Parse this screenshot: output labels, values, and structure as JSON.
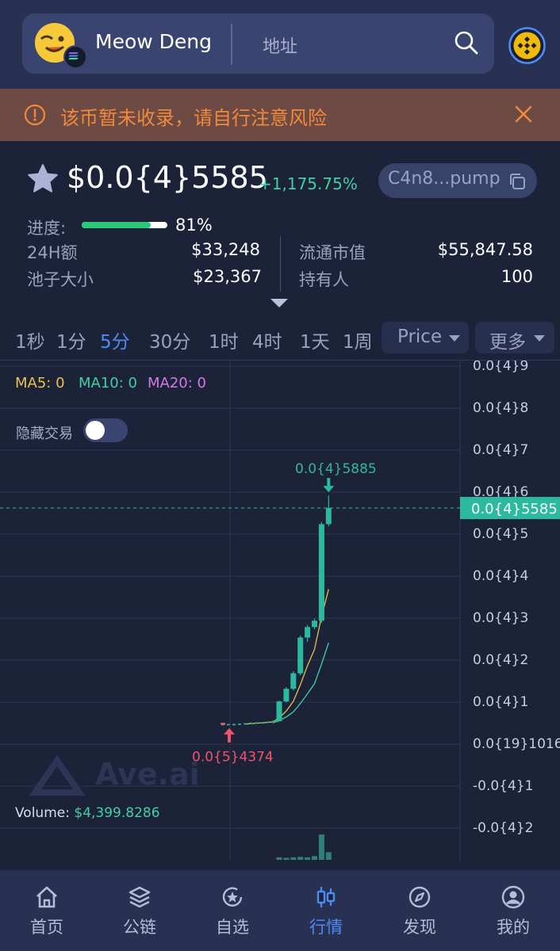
{
  "header": {
    "token_name": "Meow Deng",
    "address_placeholder": "地址",
    "icons": [
      "token-avatar-icon",
      "solana-chain-icon",
      "search-icon",
      "bnb-chain-icon"
    ]
  },
  "warning": {
    "text": "该币暂未收录，请自行注意风险",
    "color": "#f08a3a"
  },
  "token": {
    "price": "$0.0{4}5585",
    "change": "+1,175.75%",
    "address": "C4n8...pump"
  },
  "stats": {
    "progress_label": "进度:",
    "progress_percent": 81,
    "progress_text": "81%",
    "volume_24h_label": "24H额",
    "volume_24h": "$33,248",
    "pool_label": "池子大小",
    "pool": "$23,367",
    "mcap_label": "流通市值",
    "mcap": "$55,847.58",
    "holders_label": "持有人",
    "holders": "100"
  },
  "timeframes": {
    "items": [
      "1秒",
      "1分",
      "5分",
      "30分",
      "1时",
      "4时",
      "1天",
      "1周"
    ],
    "active": "5分",
    "price_dropdown": "Price",
    "more_dropdown": "更多"
  },
  "chart": {
    "ma5": "MA5: 0",
    "ma10": "MA10: 0",
    "ma20": "MA20: 0",
    "hide_trades_label": "隐藏交易",
    "watermark": "Ave.ai",
    "volume_label": "Volume:",
    "volume_value": "$4,399.8286",
    "current_price_tag": "0.0{4}5585",
    "high_label": "0.0{4}5885",
    "low_label": "0.0{5}4374",
    "y_axis": [
      "0.0{4}9",
      "0.0{4}8",
      "0.0{4}7",
      "0.0{4}6",
      "0.0{4}5",
      "0.0{4}4",
      "0.0{4}3",
      "0.0{4}2",
      "0.0{4}1",
      "0.0{19}1016",
      "-0.0{4}1",
      "-0.0{4}2"
    ],
    "colors": {
      "up": "#2bb9a0",
      "down": "#f0556b",
      "ma5": "#e8c34a",
      "ma10": "#3fd0a4",
      "ma20": "#d478e6"
    }
  },
  "chart_data": {
    "type": "candlestick",
    "y_unit": "price (units of 1e-5)",
    "ylim": [
      -2.2,
      9.2
    ],
    "candles": [
      {
        "o": 0.44,
        "h": 0.47,
        "l": 0.42,
        "c": 0.43
      },
      {
        "o": 0.43,
        "h": 0.44,
        "l": 0.42,
        "c": 0.44
      },
      {
        "o": 0.44,
        "h": 0.45,
        "l": 0.43,
        "c": 0.44
      },
      {
        "o": 0.44,
        "h": 0.45,
        "l": 0.43,
        "c": 0.45
      },
      {
        "o": 0.45,
        "h": 0.46,
        "l": 0.44,
        "c": 0.46
      },
      {
        "o": 0.46,
        "h": 0.48,
        "l": 0.45,
        "c": 0.47
      },
      {
        "o": 0.47,
        "h": 0.48,
        "l": 0.46,
        "c": 0.48
      },
      {
        "o": 0.48,
        "h": 0.49,
        "l": 0.47,
        "c": 0.48
      },
      {
        "o": 0.48,
        "h": 0.5,
        "l": 0.47,
        "c": 0.5
      },
      {
        "o": 0.5,
        "h": 0.52,
        "l": 0.49,
        "c": 0.51
      },
      {
        "o": 0.51,
        "h": 1.0,
        "l": 0.5,
        "c": 0.98
      },
      {
        "o": 0.98,
        "h": 1.32,
        "l": 0.95,
        "c": 1.28
      },
      {
        "o": 1.28,
        "h": 1.7,
        "l": 1.24,
        "c": 1.65
      },
      {
        "o": 1.65,
        "h": 2.55,
        "l": 1.6,
        "c": 2.5
      },
      {
        "o": 2.5,
        "h": 2.8,
        "l": 2.4,
        "c": 2.75
      },
      {
        "o": 2.75,
        "h": 2.95,
        "l": 2.7,
        "c": 2.9
      },
      {
        "o": 2.9,
        "h": 5.25,
        "l": 2.85,
        "c": 5.2
      },
      {
        "o": 5.2,
        "h": 5.885,
        "l": 5.15,
        "c": 5.585
      }
    ],
    "ma5": [
      null,
      null,
      null,
      null,
      0.44,
      0.45,
      0.46,
      0.47,
      0.48,
      0.49,
      0.59,
      0.75,
      0.98,
      1.38,
      1.83,
      2.22,
      3.0,
      3.65
    ],
    "ma10": [
      null,
      null,
      null,
      null,
      null,
      null,
      null,
      null,
      null,
      0.47,
      0.52,
      0.61,
      0.73,
      0.93,
      1.16,
      1.4,
      1.87,
      2.38
    ],
    "volume": [
      0.05,
      0.03,
      0.04,
      0.03,
      0.03,
      0.04,
      0.03,
      0.03,
      0.04,
      0.05,
      0.1,
      0.08,
      0.1,
      0.12,
      0.1,
      0.15,
      1.0,
      0.3
    ]
  },
  "nav": {
    "items": [
      {
        "label": "首页",
        "icon": "home-icon"
      },
      {
        "label": "公链",
        "icon": "layers-icon"
      },
      {
        "label": "自选",
        "icon": "star-refresh-icon"
      },
      {
        "label": "行情",
        "icon": "candlestick-icon"
      },
      {
        "label": "发现",
        "icon": "compass-icon"
      },
      {
        "label": "我的",
        "icon": "user-icon"
      }
    ],
    "active": "行情"
  }
}
